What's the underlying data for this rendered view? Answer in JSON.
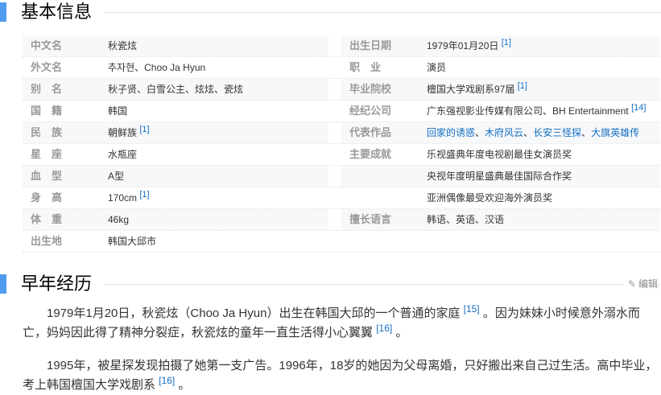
{
  "section1": {
    "title": "基本信息"
  },
  "rows": [
    {
      "lk": "中文名",
      "lv": "秋瓷炫",
      "lsup": "",
      "rk": "出生日期",
      "rv": "1979年01月20日",
      "rsup": "[1]",
      "shade": true
    },
    {
      "lk": "外文名",
      "lv": "추자현、Choo Ja Hyun",
      "lsup": "",
      "rk": "职　业",
      "rv": "演员",
      "rsup": "",
      "shade": false
    },
    {
      "lk": "别　名",
      "lv": "秋子贤、白雪公主、炫炫、瓷炫",
      "lsup": "",
      "rk": "毕业院校",
      "rv": "檀国大学戏剧系97届",
      "rsup": "[1]",
      "shade": true
    },
    {
      "lk": "国　籍",
      "lv": "韩国",
      "lsup": "",
      "rk": "经纪公司",
      "rv": "广东强视影业传媒有限公司、BH Entertainment",
      "rsup": "[14]",
      "shade": false
    },
    {
      "lk": "民　族",
      "lv": "朝鲜族",
      "lsup": "[1]",
      "rk": "代表作品",
      "rv": "",
      "rsup": "",
      "shade": true
    },
    {
      "lk": "星　座",
      "lv": "水瓶座",
      "lsup": "",
      "rk": "主要成就",
      "rv": "乐视盛典年度电视剧最佳女演员奖",
      "rsup": "",
      "shade": false
    },
    {
      "lk": "血　型",
      "lv": "A型",
      "lsup": "",
      "rk": "",
      "rv": "央视年度明星盛典最佳国际合作奖",
      "rsup": "",
      "shade": true
    },
    {
      "lk": "身　高",
      "lv": "170cm",
      "lsup": "[1]",
      "rk": "",
      "rv": "亚洲偶像最受欢迎海外演员奖",
      "rsup": "",
      "shade": false
    },
    {
      "lk": "体　重",
      "lv": "46kg",
      "lsup": "",
      "rk": "擅长语言",
      "rv": "韩语、英语、汉语",
      "rsup": "",
      "shade": true
    },
    {
      "lk": "出生地",
      "lv": "韩国大邱市",
      "lsup": "",
      "rk": "",
      "rv": "",
      "rsup": "",
      "shade": false
    }
  ],
  "works": [
    "回家的诱惑",
    "木府风云",
    "长安三怪探",
    "大旗英雄传"
  ],
  "works_sep": "、",
  "section2": {
    "title": "早年经历",
    "edit_label": "编辑",
    "edit_icon": "pencil-icon"
  },
  "para1": {
    "text": "1979年1月20日，秋瓷炫（Choo Ja Hyun）出生在韩国大邱的一个普通的家庭",
    "sup1": "[15]",
    "text2": "。因为妹妹小时候意外溺水而亡，妈妈因此得了精神分裂症，秋瓷炫的童年一直生活得小心翼翼",
    "sup2": "[16]",
    "text3": "。"
  },
  "para2": {
    "text": "1995年，被星探发现拍摄了她第一支广告。1996年，18岁的她因为父母离婚，只好搬出来自己过生活。高中毕业，考上韩国檀国大学戏剧系",
    "sup1": "[16]",
    "text2": "。"
  }
}
